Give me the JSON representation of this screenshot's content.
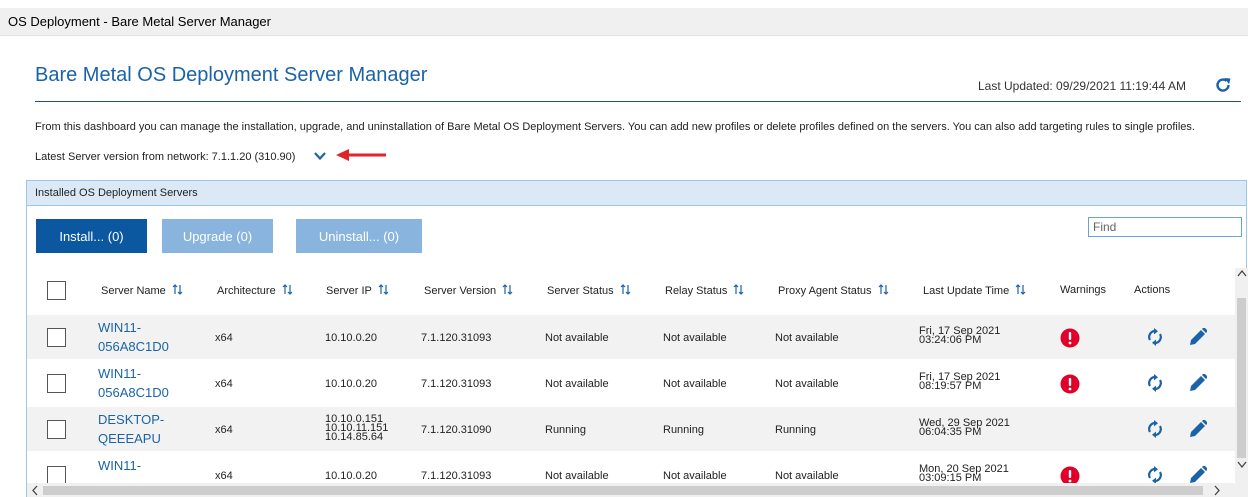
{
  "window": {
    "title": "OS Deployment - Bare Metal Server Manager"
  },
  "header": {
    "title": "Bare Metal OS Deployment Server Manager",
    "last_updated": "Last Updated: 09/29/2021 11:19:44 AM",
    "refresh_icon": "refresh-icon"
  },
  "description": "From this dashboard you can manage the installation, upgrade, and uninstallation of Bare Metal OS Deployment Servers. You can add new profiles or delete profiles defined on the servers. You can also add targeting rules to single profiles.",
  "latest_version": "Latest Server version from network: 7.1.1.20 (310.90)",
  "panel": {
    "title": "Installed OS Deployment Servers",
    "buttons": {
      "install": "Install... (0)",
      "upgrade": "Upgrade (0)",
      "uninstall": "Uninstall... (0)"
    },
    "find_placeholder": "Find"
  },
  "columns": {
    "server_name": "Server Name",
    "architecture": "Architecture",
    "server_ip": "Server IP",
    "server_version": "Server Version",
    "server_status": "Server Status",
    "relay_status": "Relay Status",
    "proxy_agent_status": "Proxy Agent Status",
    "last_update_time": "Last Update Time",
    "warnings": "Warnings",
    "actions": "Actions"
  },
  "rows": [
    {
      "name_1": "WIN11-",
      "name_2": "056A8C1D0",
      "arch": "x64",
      "ip": [
        "10.10.0.20"
      ],
      "version": "7.1.120.31093",
      "server_status": "Not available",
      "relay_status": "Not available",
      "proxy_status": "Not available",
      "time_1": "Fri, 17 Sep 2021",
      "time_2": "03:24:06 PM",
      "warning": true
    },
    {
      "name_1": "WIN11-",
      "name_2": "056A8C1D0",
      "arch": "x64",
      "ip": [
        "10.10.0.20"
      ],
      "version": "7.1.120.31093",
      "server_status": "Not available",
      "relay_status": "Not available",
      "proxy_status": "Not available",
      "time_1": "Fri, 17 Sep 2021",
      "time_2": "08:19:57 PM",
      "warning": true
    },
    {
      "name_1": "DESKTOP-",
      "name_2": "QEEEAPU",
      "arch": "x64",
      "ip": [
        "10.10.0.151",
        "10.10.11.151",
        "10.14.85.64"
      ],
      "version": "7.1.120.31090",
      "server_status": "Running",
      "relay_status": "Running",
      "proxy_status": "Running",
      "time_1": "Wed, 29 Sep 2021",
      "time_2": "06:04:35 PM",
      "warning": false
    },
    {
      "name_1": "WIN11-",
      "name_2": "",
      "arch": "x64",
      "ip": [
        "10.10.0.20"
      ],
      "version": "7.1.120.31093",
      "server_status": "Not available",
      "relay_status": "Not available",
      "proxy_status": "Not available",
      "time_1": "Mon, 20 Sep 2021",
      "time_2": "03:09:15 PM",
      "warning": true
    }
  ],
  "colors": {
    "accent": "#1a63a8",
    "primary_button": "#0b57a0",
    "disabled_button": "#88b4dd",
    "warning": "#e0002a",
    "annotation_arrow": "#e0242a"
  },
  "icons": {
    "sort": "sort-icon",
    "warning": "warning-icon",
    "sync": "sync-icon",
    "edit": "edit-icon",
    "expand": "chevron-down-icon"
  }
}
